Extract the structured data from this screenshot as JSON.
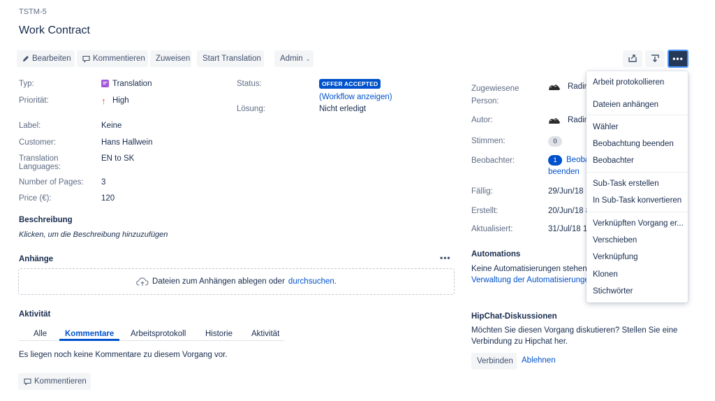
{
  "issue": {
    "key": "TSTM-5",
    "title": "Work Contract"
  },
  "toolbar": {
    "edit": "Bearbeiten",
    "comment": "Kommentieren",
    "assign": "Zuweisen",
    "start_translation": "Start Translation",
    "admin": "Admin",
    "share_icon": "share-icon",
    "export_icon": "export-icon",
    "more_icon": "more-icon"
  },
  "details": {
    "type_label": "Typ:",
    "type_value": "Translation",
    "priority_label": "Priorität:",
    "priority_value": "High",
    "status_label": "Status:",
    "status_value": "OFFER ACCEPTED",
    "workflow_link": "(Workflow anzeigen)",
    "resolution_label": "Lösung:",
    "resolution_value": "Nicht erledigt",
    "label_label": "Label:",
    "label_value": "Keine",
    "customer_label": "Customer:",
    "customer_value": "Hans Hallwein",
    "languages_label_1": "Translation",
    "languages_label_2": "Languages:",
    "languages_value": "EN to SK",
    "pages_label": "Number of Pages:",
    "pages_value": "3",
    "price_label": "Price (€):",
    "price_value": "120"
  },
  "description": {
    "title": "Beschreibung",
    "placeholder": "Klicken, um die Beschreibung hinzuzufügen"
  },
  "attachments": {
    "title": "Anhänge",
    "drop_text": "Dateien zum Anhängen ablegen oder",
    "browse_link": "durchsuchen."
  },
  "activity": {
    "title": "Aktivität",
    "tabs": [
      "Alle",
      "Kommentare",
      "Arbeitsprotokoll",
      "Historie",
      "Aktivität"
    ],
    "empty": "Es liegen noch keine Kommentare zu diesem Vorgang vor.",
    "comment_button": "Kommentieren"
  },
  "people": {
    "assignee_label_1": "Zugewiesene",
    "assignee_label_2": "Person:",
    "assignee_value": "Radin",
    "author_label": "Autor:",
    "author_value": "Radin",
    "votes_label": "Stimmen:",
    "votes_value": "0",
    "watchers_label": "Beobachter:",
    "watchers_count": "1",
    "watchers_link_1": "Beoba",
    "watchers_link_2": "beenden"
  },
  "dates": {
    "due_label": "Fällig:",
    "due_value": "29/Jun/18",
    "created_label": "Erstellt:",
    "created_value": "20/Jun/18 8",
    "updated_label": "Aktualisiert:",
    "updated_value": "31/Jul/18 1("
  },
  "automations": {
    "title": "Automations",
    "text": "Keine Automatisierungen stehen z",
    "link": "Verwaltung der Automatisierungen"
  },
  "hipchat": {
    "title": "HipChat-Diskussionen",
    "text_1": "Möchten Sie diesen Vorgang diskutieren? Stellen Sie eine",
    "text_2": "Verbindung zu Hipchat her.",
    "connect": "Verbinden",
    "decline": "Ablehnen"
  },
  "more_menu": {
    "items": [
      "Arbeit protokollieren",
      "Dateien anhängen",
      "Wähler",
      "Beobachtung beenden",
      "Beobachter",
      "Sub-Task erstellen",
      "In Sub-Task konvertieren",
      "Verknüpften Vorgang er...",
      "Verschieben",
      "Verknüpfung",
      "Klonen",
      "Stichwörter"
    ]
  },
  "colors": {
    "accent": "#0052cc",
    "priority_high": "#e5493a",
    "type_icon": "#a259d9"
  }
}
